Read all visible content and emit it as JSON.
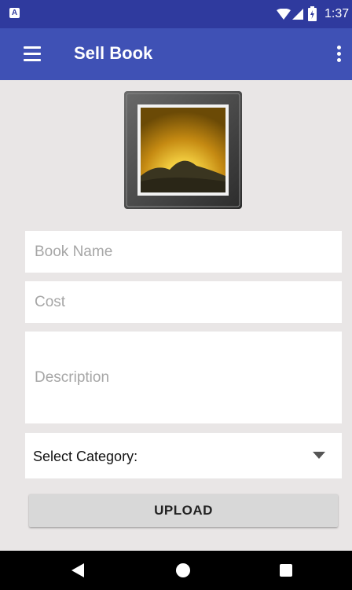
{
  "status_bar": {
    "notification_icon": "A",
    "time": "1:37",
    "icons": [
      "wifi-icon",
      "signal-icon",
      "battery-icon"
    ]
  },
  "app_bar": {
    "title": "Sell Book",
    "menu_icon": "menu-icon",
    "more_icon": "more-vert-icon"
  },
  "form": {
    "image_icon": "image-placeholder-icon",
    "book_name_placeholder": "Book Name",
    "cost_placeholder": "Cost",
    "description_placeholder": "Description",
    "category_label": "Select Category:",
    "upload_label": "UPLOAD"
  },
  "nav_bar": {
    "icons": [
      "back-icon",
      "home-icon",
      "recents-icon"
    ]
  },
  "colors": {
    "status_bar": "#2f3a9e",
    "app_bar": "#3f51b5",
    "background": "#e9e6e6",
    "button": "#d8d8d8"
  }
}
